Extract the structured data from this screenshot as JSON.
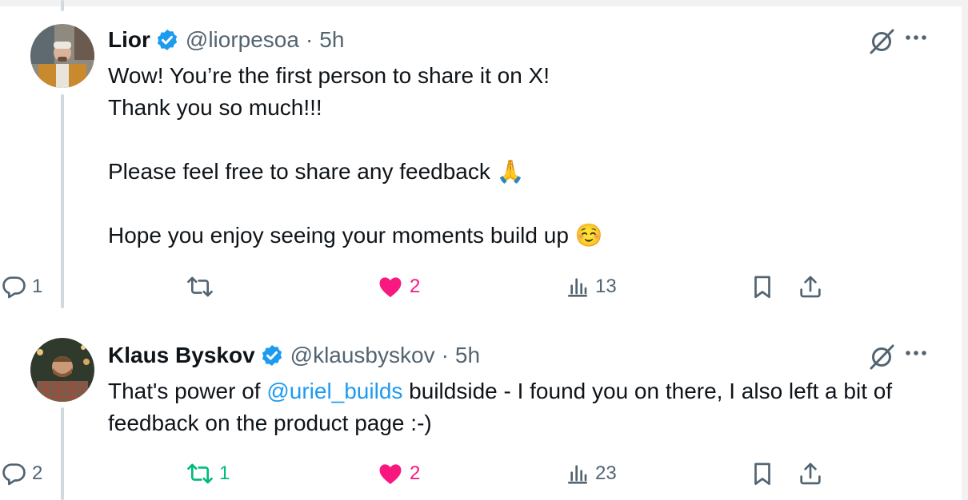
{
  "tweets": [
    {
      "author_name": "Lior",
      "handle": "@liorpesoa",
      "separator": "·",
      "time": "5h",
      "lines": [
        "Wow! You’re the first person to share it on X!",
        "Thank you so much!!!",
        "",
        "Please feel free to share any feedback 🙏",
        "",
        "Hope you enjoy seeing your moments build up ☺️"
      ],
      "replies": "1",
      "reposts": "",
      "likes": "2",
      "views": "13",
      "liked": true,
      "reposted": false
    },
    {
      "author_name": "Klaus Byskov",
      "handle": "@klausbyskov",
      "separator": "·",
      "time": "5h",
      "text_before": "That's power of ",
      "mention": "@uriel_builds",
      "text_after": " buildside - I found you on there, I also left a bit of feedback on the product page :-)",
      "replies": "2",
      "reposts": "1",
      "likes": "2",
      "views": "23",
      "liked": true,
      "reposted": true
    }
  ],
  "icons": {
    "verified": "verified-badge-icon",
    "grok": "grok-icon",
    "more": "more-icon",
    "reply": "reply-icon",
    "repost": "repost-icon",
    "like": "heart-icon",
    "views": "views-icon",
    "bookmark": "bookmark-icon",
    "share": "share-icon"
  },
  "colors": {
    "verified_blue": "#1d9bf0",
    "like_pink": "#f91880",
    "repost_green": "#00ba7c",
    "secondary_text": "#536471",
    "thread_line": "#cfd9de"
  }
}
